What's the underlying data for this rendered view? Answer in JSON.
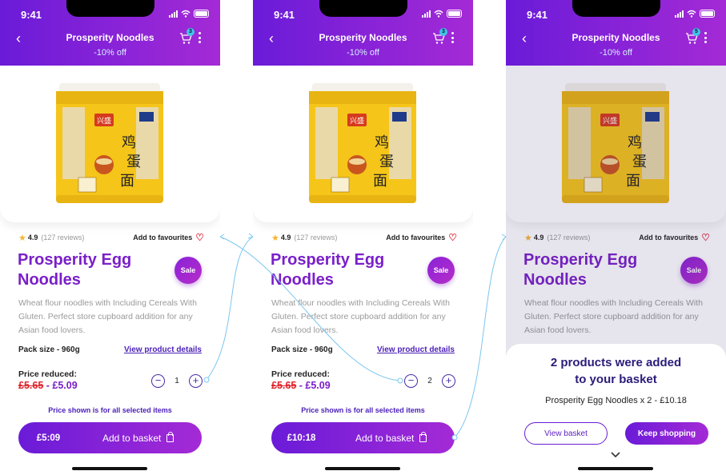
{
  "status_bar": {
    "time": "9:41"
  },
  "colors": {
    "accent": "#7a1fc9",
    "header_start": "#6a1bd8",
    "header_end": "#a42ad6",
    "sale_red": "#e0202a",
    "badge": "#3fc4e6",
    "link": "#4a1fb8"
  },
  "icons": [
    "back-arrow-icon",
    "cart-icon",
    "more-vertical-icon",
    "star-icon",
    "heart-icon",
    "minus-icon",
    "plus-icon",
    "shopping-bag-icon",
    "chevron-down-icon"
  ],
  "screens": [
    {
      "header": {
        "back": "‹",
        "title": "Prosperity Noodles",
        "discount": "-10% off",
        "cart_count": "3"
      },
      "rating": {
        "value": "4.9",
        "reviews": "(127 reviews)",
        "favourite_label": "Add to favourites"
      },
      "product": {
        "title": "Prosperity Egg Noodles",
        "sale_badge": "Sale",
        "description": "Wheat flour noodles with Including Cereals With Gluten. Perfect store cupboard addition for any Asian food lovers.",
        "pack_size": "Pack size - 960g",
        "details_link": "View product details",
        "price_label": "Price reduced:",
        "old_price": "£5.65",
        "separator": " - ",
        "new_price": "£5.09"
      },
      "quantity": {
        "minus": "−",
        "value": "1",
        "plus": "+"
      },
      "note": "Price shown is for all selected items",
      "basket": {
        "total": "£5:09",
        "label": "Add to basket"
      }
    },
    {
      "header": {
        "back": "‹",
        "title": "Prosperity Noodles",
        "discount": "-10% off",
        "cart_count": "3"
      },
      "rating": {
        "value": "4.9",
        "reviews": "(127 reviews)",
        "favourite_label": "Add to favourites"
      },
      "product": {
        "title": "Prosperity Egg Noodles",
        "sale_badge": "Sale",
        "description": "Wheat flour noodles with Including Cereals With Gluten. Perfect store cupboard addition for any Asian food lovers.",
        "pack_size": "Pack size - 960g",
        "details_link": "View product details",
        "price_label": "Price reduced:",
        "old_price": "£5.65",
        "separator": " - ",
        "new_price": "£5.09"
      },
      "quantity": {
        "minus": "−",
        "value": "2",
        "plus": "+"
      },
      "note": "Price shown is for all selected items",
      "basket": {
        "total": "£10:18",
        "label": "Add to basket"
      }
    },
    {
      "header": {
        "back": "‹",
        "title": "Prosperity Noodles",
        "discount": "-10% off",
        "cart_count": "5"
      },
      "rating": {
        "value": "4.9",
        "reviews": "(127 reviews)",
        "favourite_label": "Add to favourites"
      },
      "product": {
        "title": "Prosperity Egg Noodles",
        "sale_badge": "Sale",
        "description": "Wheat flour noodles with Including Cereals With Gluten. Perfect store cupboard addition for any Asian food lovers."
      },
      "confirmation": {
        "title_line1": "2 products were added",
        "title_line2": "to your basket",
        "summary": "Prosperity Egg Noodles x 2 - £10.18",
        "view_basket": "View basket",
        "keep_shopping": "Keep shopping"
      }
    }
  ]
}
